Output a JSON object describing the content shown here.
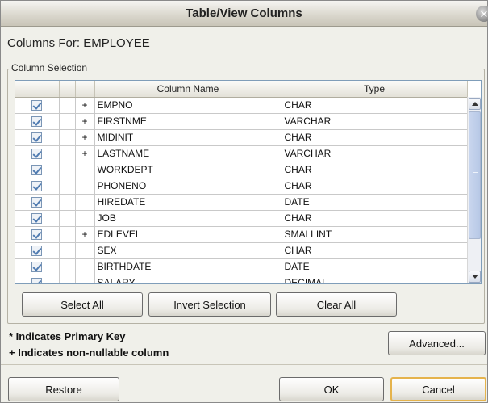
{
  "window": {
    "title": "Table/View Columns"
  },
  "header": {
    "columns_for": "Columns For: EMPLOYEE"
  },
  "group": {
    "legend": "Column Selection"
  },
  "table": {
    "headers": [
      "",
      "",
      "",
      "Column Name",
      "Type"
    ],
    "rows": [
      {
        "checked": true,
        "pk": "",
        "nn": "+",
        "name": "EMPNO",
        "type": "CHAR"
      },
      {
        "checked": true,
        "pk": "",
        "nn": "+",
        "name": "FIRSTNME",
        "type": "VARCHAR"
      },
      {
        "checked": true,
        "pk": "",
        "nn": "+",
        "name": "MIDINIT",
        "type": "CHAR"
      },
      {
        "checked": true,
        "pk": "",
        "nn": "+",
        "name": "LASTNAME",
        "type": "VARCHAR"
      },
      {
        "checked": true,
        "pk": "",
        "nn": "",
        "name": "WORKDEPT",
        "type": "CHAR"
      },
      {
        "checked": true,
        "pk": "",
        "nn": "",
        "name": "PHONENO",
        "type": "CHAR"
      },
      {
        "checked": true,
        "pk": "",
        "nn": "",
        "name": "HIREDATE",
        "type": "DATE"
      },
      {
        "checked": true,
        "pk": "",
        "nn": "",
        "name": "JOB",
        "type": "CHAR"
      },
      {
        "checked": true,
        "pk": "",
        "nn": "+",
        "name": "EDLEVEL",
        "type": "SMALLINT"
      },
      {
        "checked": true,
        "pk": "",
        "nn": "",
        "name": "SEX",
        "type": "CHAR"
      },
      {
        "checked": true,
        "pk": "",
        "nn": "",
        "name": "BIRTHDATE",
        "type": "DATE"
      },
      {
        "checked": true,
        "pk": "",
        "nn": "",
        "name": "SALARY",
        "type": "DECIMAL"
      }
    ]
  },
  "buttons": {
    "select_all": "Select All",
    "invert_selection": "Invert Selection",
    "clear_all": "Clear All",
    "advanced": "Advanced...",
    "restore": "Restore",
    "ok": "OK",
    "cancel": "Cancel"
  },
  "legend": {
    "primary_key": "* Indicates Primary Key",
    "non_nullable": "+ Indicates non-nullable column"
  },
  "icons": {
    "close": "close-icon",
    "check": "checkbox-checked-icon"
  },
  "colors": {
    "default_button_border": "#e5b34c",
    "grid_border": "#7f9db9"
  }
}
